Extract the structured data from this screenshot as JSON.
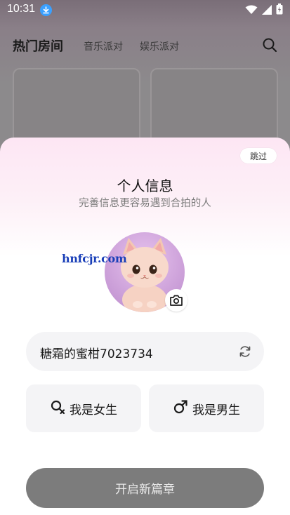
{
  "status_bar": {
    "time": "10:31"
  },
  "header": {
    "title": "热门房间",
    "tabs": [
      "音乐派对",
      "娱乐派对"
    ]
  },
  "sheet": {
    "skip_label": "跳过",
    "title": "个人信息",
    "subtitle": "完善信息更容易遇到合拍的人",
    "watermark": "hnfcjr.com",
    "nickname": "糖霜的蜜柑7023734",
    "gender_female": "我是女生",
    "gender_male": "我是男生",
    "submit_label": "开启新篇章"
  },
  "icons": {
    "download": "download-icon",
    "wifi": "wifi-icon",
    "signal": "signal-icon",
    "battery": "battery-icon",
    "search": "search-icon",
    "camera": "camera-icon",
    "refresh": "refresh-icon",
    "female": "female-icon",
    "male": "male-icon"
  },
  "colors": {
    "submit_bg": "#7c7c7c",
    "sheet_top": "#fde6f4",
    "field_bg": "#f4f4f6"
  }
}
